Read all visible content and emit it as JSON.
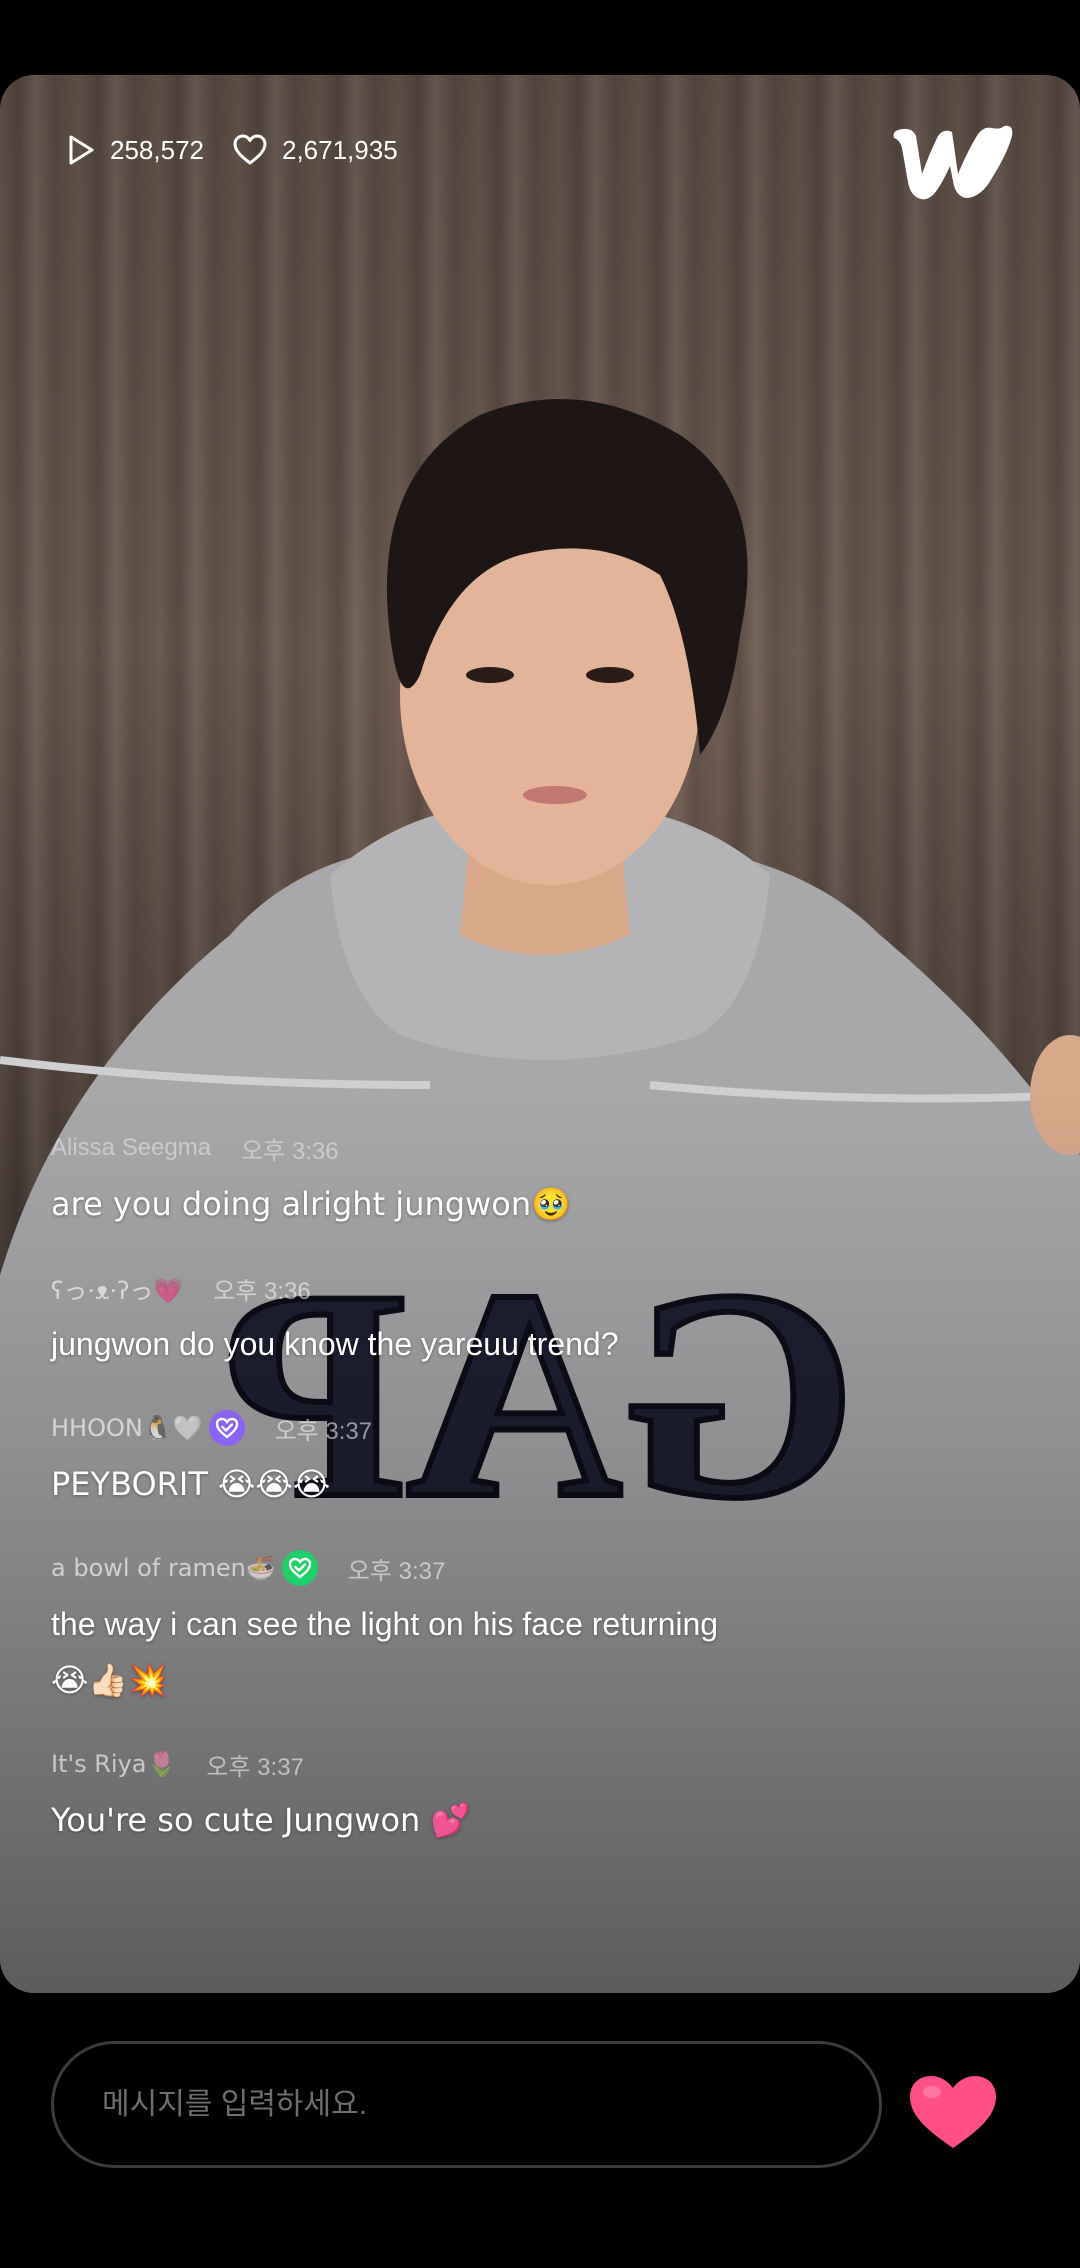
{
  "stats": {
    "views": "258,572",
    "likes": "2,671,935"
  },
  "brand": {
    "logo_icon": "weverse-logo",
    "accent": "#ff4f84"
  },
  "chat": [
    {
      "user": "Alissa Seegma",
      "time": "오후 3:36",
      "text": "are you doing alright jungwon🥹"
    },
    {
      "user": "ʕっ·ᴥ·ʔっ💗",
      "time": "오후 3:36",
      "text": "jungwon do you know the yareuu trend?"
    },
    {
      "user": "HHOON🐧🤍",
      "time": "오후 3:37",
      "text": "PEYBORIT 😭😭😭"
    },
    {
      "user": "a bowl of ramen🍜",
      "time": "오후 3:37",
      "text": "the way i can see the light on his face returning",
      "text2": "😭👍🏻💥"
    },
    {
      "user": "It's Riya🌷",
      "time": "오후 3:37",
      "text": "You're so cute Jungwon 💕"
    }
  ],
  "input": {
    "placeholder": "메시지를 입력하세요."
  },
  "colors": {
    "heart": "#ff4f84",
    "badge_purple": "#8a63f5",
    "badge_green": "#1fcf6a"
  }
}
